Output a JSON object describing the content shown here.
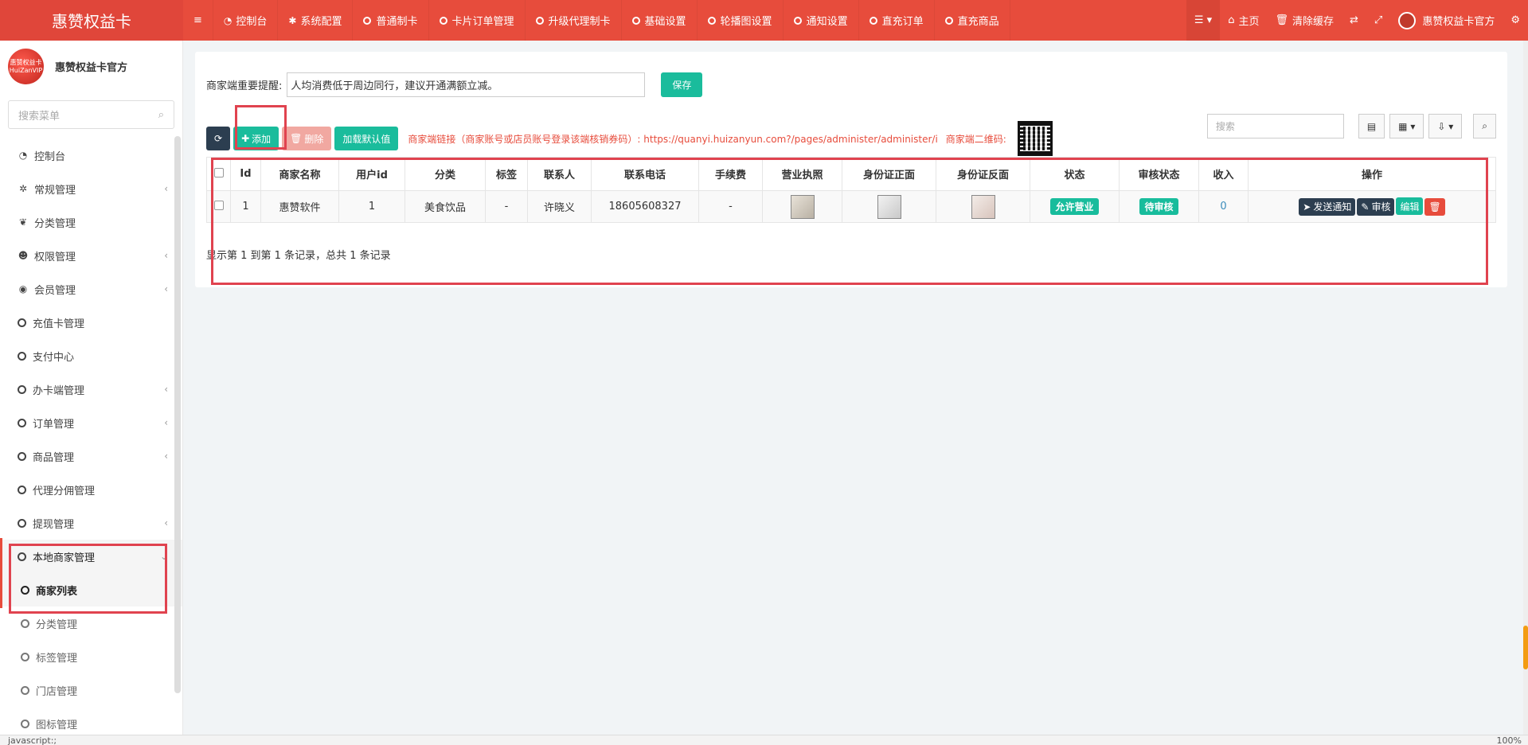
{
  "app": {
    "brand": "惠赞权益卡"
  },
  "topnav": {
    "menu_toggle": "≡",
    "items": [
      {
        "label": "控制台",
        "icon": "dashboard-icon"
      },
      {
        "label": "系统配置",
        "icon": "gear-icon"
      },
      {
        "label": "普通制卡",
        "icon": "circle-icon"
      },
      {
        "label": "卡片订单管理",
        "icon": "circle-icon"
      },
      {
        "label": "升级代理制卡",
        "icon": "circle-icon"
      },
      {
        "label": "基础设置",
        "icon": "circle-icon"
      },
      {
        "label": "轮播图设置",
        "icon": "circle-icon"
      },
      {
        "label": "通知设置",
        "icon": "circle-icon"
      },
      {
        "label": "直充订单",
        "icon": "circle-icon"
      },
      {
        "label": "直充商品",
        "icon": "circle-icon"
      }
    ],
    "right": {
      "home": "主页",
      "clear_cache": "清除缓存",
      "user_name": "惠赞权益卡官方"
    }
  },
  "sidebar": {
    "avatar_text": "惠赞权益卡 HuiZanVIP",
    "user_name": "惠赞权益卡官方",
    "search_placeholder": "搜索菜单",
    "items": [
      {
        "label": "控制台",
        "icon": "dashboard-icon",
        "chevron": false
      },
      {
        "label": "常规管理",
        "icon": "cogs-icon",
        "chevron": true
      },
      {
        "label": "分类管理",
        "icon": "leaf-icon",
        "chevron": false
      },
      {
        "label": "权限管理",
        "icon": "group-icon",
        "chevron": true
      },
      {
        "label": "会员管理",
        "icon": "user-circle-icon",
        "chevron": true
      },
      {
        "label": "充值卡管理",
        "icon": "circle-icon",
        "chevron": false
      },
      {
        "label": "支付中心",
        "icon": "circle-icon",
        "chevron": false
      },
      {
        "label": "办卡端管理",
        "icon": "circle-icon",
        "chevron": true
      },
      {
        "label": "订单管理",
        "icon": "circle-icon",
        "chevron": true
      },
      {
        "label": "商品管理",
        "icon": "circle-icon",
        "chevron": true
      },
      {
        "label": "代理分佣管理",
        "icon": "circle-icon",
        "chevron": false
      },
      {
        "label": "提现管理",
        "icon": "circle-icon",
        "chevron": true
      },
      {
        "label": "本地商家管理",
        "icon": "circle-icon",
        "chevron": true
      }
    ],
    "subitems": [
      {
        "label": "商家列表"
      },
      {
        "label": "分类管理"
      },
      {
        "label": "标签管理"
      },
      {
        "label": "门店管理"
      },
      {
        "label": "图标管理"
      }
    ]
  },
  "notice": {
    "label": "商家端重要提醒:",
    "value": "人均消费低于周边同行，建议开通满额立减。",
    "save": "保存"
  },
  "toolbar": {
    "add": "添加",
    "delete": "删除",
    "load_default": "加载默认值",
    "link_text": "商家端链接（商家账号或店员账号登录该端核销券码）: https://quanyi.huizanyun.com?/pages/administer/administer/i",
    "qr_label": "商家端二维码:",
    "search_placeholder": "搜索"
  },
  "table": {
    "headers": [
      "Id",
      "商家名称",
      "用户id",
      "分类",
      "标签",
      "联系人",
      "联系电话",
      "手续费",
      "营业执照",
      "身份证正面",
      "身份证反面",
      "状态",
      "审核状态",
      "收入",
      "操作"
    ],
    "rows": [
      {
        "id": "1",
        "name": "惠赞软件",
        "user_id": "1",
        "category": "美食饮品",
        "tag": "-",
        "contact": "许晓义",
        "phone": "18605608327",
        "fee": "-",
        "status": "允许营业",
        "audit": "待审核",
        "income": "0",
        "ops": {
          "notify": "发送通知",
          "review": "审核",
          "edit": "编辑"
        }
      }
    ],
    "footer": "显示第 1 到第 1 条记录，总共 1 条记录"
  },
  "statusbar": {
    "text": "javascript:;",
    "zoom": "100%"
  },
  "colors": {
    "topbar": "#e74c3c",
    "accent_green": "#1abc9c",
    "dark": "#2c3e50",
    "annotation": "#e0434f"
  }
}
